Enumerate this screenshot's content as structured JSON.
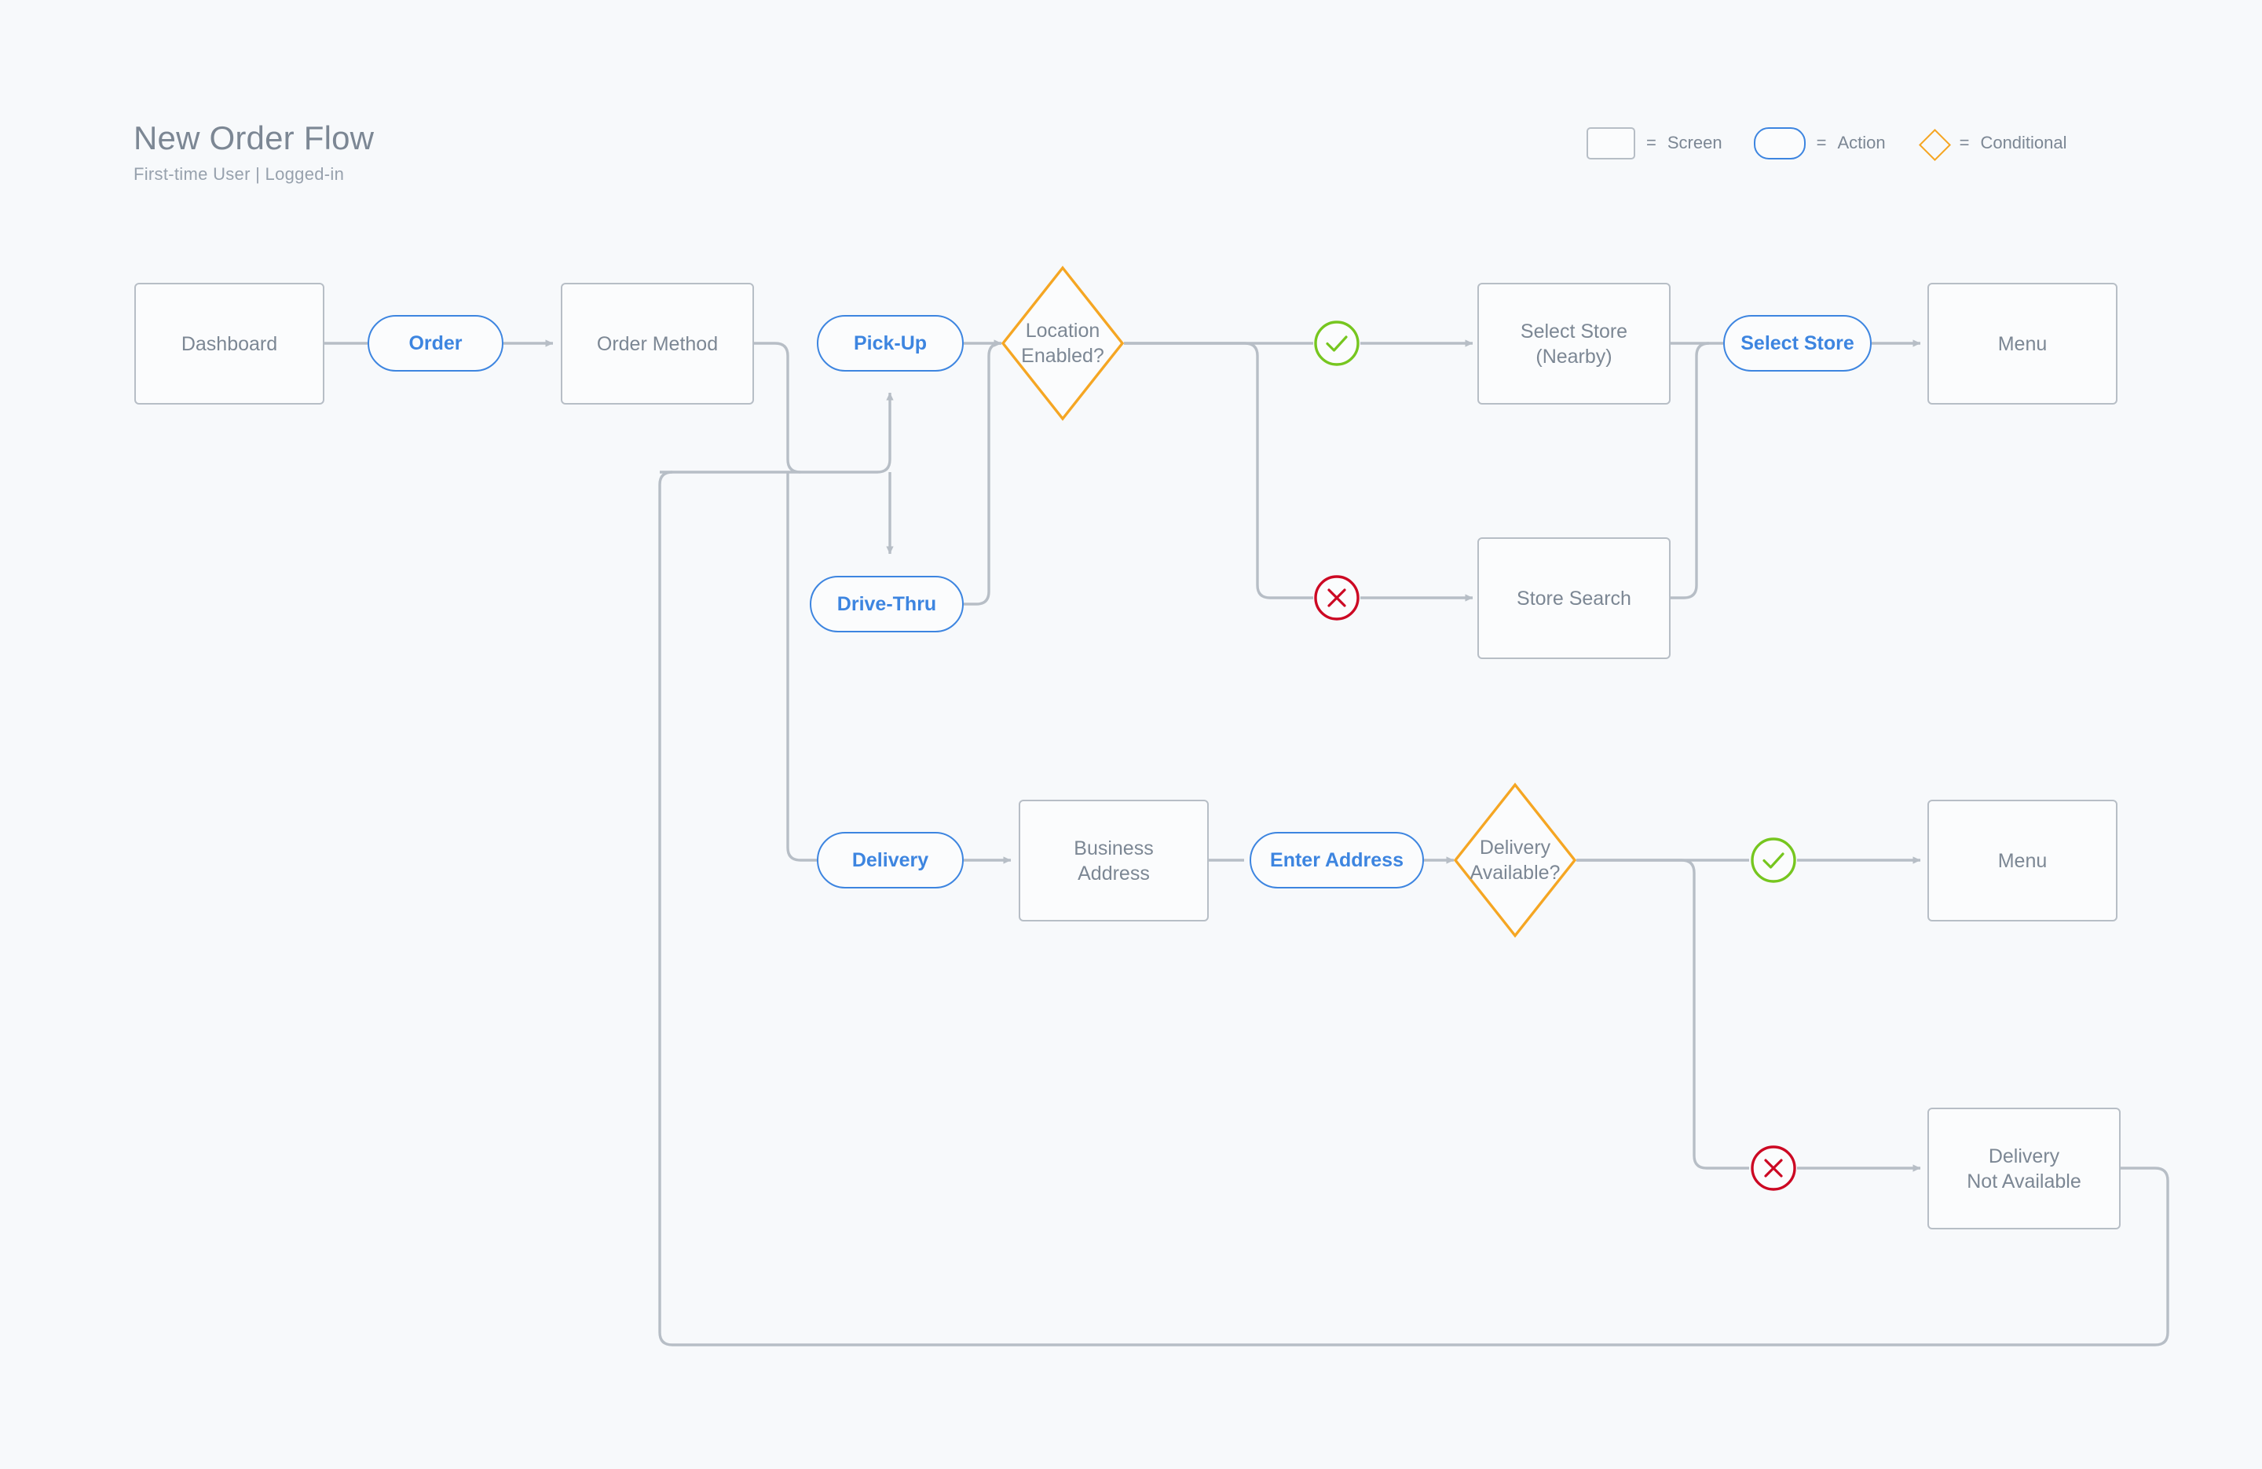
{
  "header": {
    "title": "New Order Flow",
    "subtitle": "First-time User  |  Logged-in"
  },
  "legend": {
    "equals": "=",
    "items": [
      {
        "shape": "rectangle",
        "label": "Screen",
        "color": "#b7bec6"
      },
      {
        "shape": "pill",
        "label": "Action",
        "color": "#3d85e0"
      },
      {
        "shape": "diamond",
        "label": "Conditional",
        "color": "#f5a623"
      }
    ]
  },
  "colors": {
    "background": "#f7f9fb",
    "screen_border": "#b7bec6",
    "screen_text": "#7c8794",
    "action_border": "#3d85e0",
    "action_text": "#3d85e0",
    "conditional": "#f5a623",
    "success": "#76c61f",
    "failure": "#cc0823",
    "connector": "#b7bec6",
    "title_text": "#7c8794"
  },
  "nodes": {
    "dashboard": {
      "label": "Dashboard",
      "type": "screen"
    },
    "order": {
      "label": "Order",
      "type": "action"
    },
    "order_method": {
      "label": "Order Method",
      "type": "screen"
    },
    "pickup": {
      "label": "Pick-Up",
      "type": "action"
    },
    "drive_thru": {
      "label": "Drive-Thru",
      "type": "action"
    },
    "location_enabled": {
      "label": "Location\nEnabled?",
      "line1": "Location",
      "line2": "Enabled?",
      "type": "conditional"
    },
    "select_store_nearby": {
      "label": "Select Store\n(Nearby)",
      "line1": "Select Store",
      "line2": "(Nearby)",
      "type": "screen"
    },
    "store_search": {
      "label": "Store Search",
      "type": "screen"
    },
    "select_store_action": {
      "label": "Select Store",
      "type": "action"
    },
    "menu_pickup": {
      "label": "Menu",
      "type": "screen"
    },
    "delivery": {
      "label": "Delivery",
      "type": "action"
    },
    "business_address": {
      "label": "Business\nAddress",
      "line1": "Business",
      "line2": "Address",
      "type": "screen"
    },
    "enter_address": {
      "label": "Enter Address",
      "type": "action"
    },
    "delivery_available": {
      "label": "Delivery\nAvailable?",
      "line1": "Delivery",
      "line2": "Available?",
      "type": "conditional"
    },
    "menu_delivery": {
      "label": "Menu",
      "type": "screen"
    },
    "delivery_not_available": {
      "label": "Delivery\nNot Available",
      "line1": "Delivery",
      "line2": "Not Available",
      "type": "screen"
    }
  },
  "markers": {
    "location_yes": {
      "kind": "success",
      "glyph": "check"
    },
    "location_no": {
      "kind": "failure",
      "glyph": "cross"
    },
    "delivery_yes": {
      "kind": "success",
      "glyph": "check"
    },
    "delivery_no": {
      "kind": "failure",
      "glyph": "cross"
    }
  }
}
